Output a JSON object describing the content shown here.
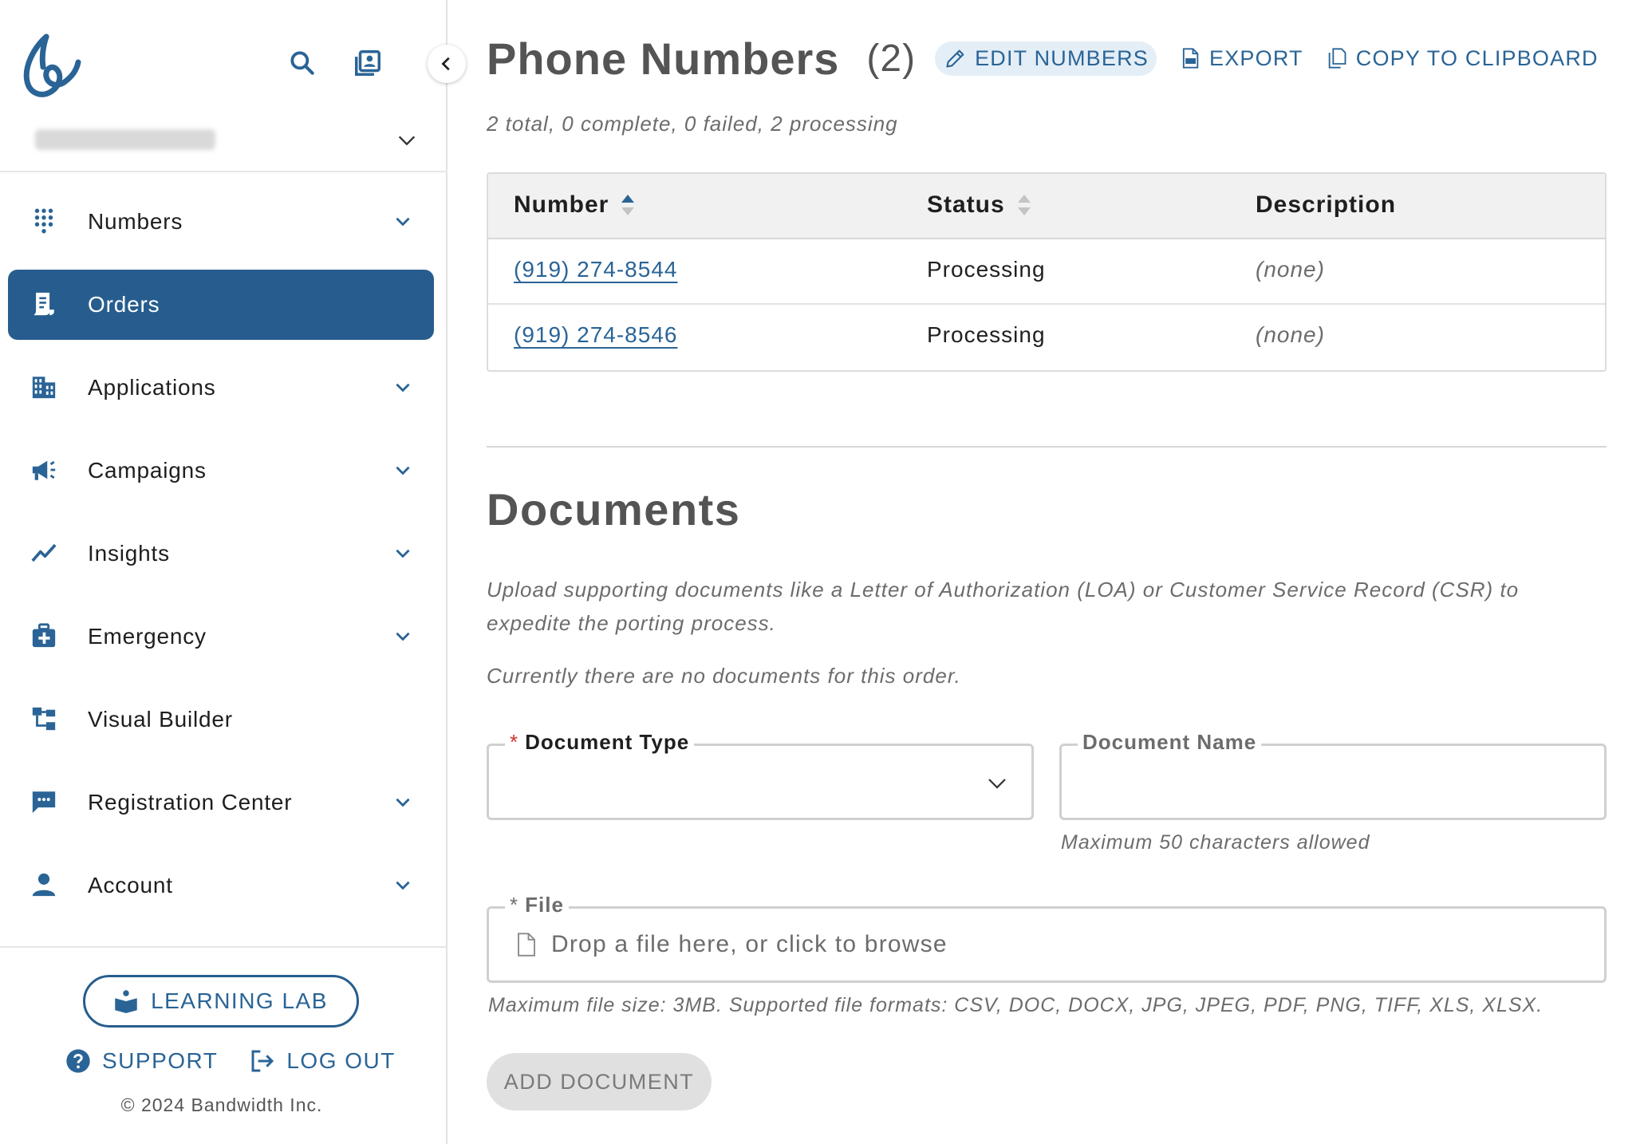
{
  "sidebar": {
    "account_chevron": "chevron-down-icon",
    "nav": [
      {
        "label": "Numbers",
        "icon": "dialpad-icon",
        "has_submenu": true,
        "active": false
      },
      {
        "label": "Orders",
        "icon": "receipt-icon",
        "has_submenu": false,
        "active": true
      },
      {
        "label": "Applications",
        "icon": "building-icon",
        "has_submenu": true,
        "active": false
      },
      {
        "label": "Campaigns",
        "icon": "megaphone-icon",
        "has_submenu": true,
        "active": false
      },
      {
        "label": "Insights",
        "icon": "trend-line-icon",
        "has_submenu": true,
        "active": false
      },
      {
        "label": "Emergency",
        "icon": "medical-kit-icon",
        "has_submenu": true,
        "active": false
      },
      {
        "label": "Visual Builder",
        "icon": "flow-builder-icon",
        "has_submenu": false,
        "active": false
      },
      {
        "label": "Registration Center",
        "icon": "chat-bubble-icon",
        "has_submenu": true,
        "active": false
      },
      {
        "label": "Account",
        "icon": "person-icon",
        "has_submenu": true,
        "active": false
      }
    ],
    "learning_lab": "LEARNING LAB",
    "support": "SUPPORT",
    "logout": "LOG OUT",
    "copyright": "© 2024 Bandwidth Inc."
  },
  "phone_numbers": {
    "title": "Phone Numbers",
    "count": "(2)",
    "actions": {
      "edit": "EDIT NUMBERS",
      "export": "EXPORT",
      "copy": "COPY TO CLIPBOARD"
    },
    "summary": "2 total, 0 complete, 0 failed, 2 processing",
    "columns": {
      "number": "Number",
      "status": "Status",
      "description": "Description"
    },
    "rows": [
      {
        "number": "(919) 274-8544",
        "status": "Processing",
        "description": "(none)"
      },
      {
        "number": "(919) 274-8546",
        "status": "Processing",
        "description": "(none)"
      }
    ]
  },
  "documents": {
    "title": "Documents",
    "description": "Upload supporting documents like a Letter of Authorization (LOA) or Customer Service Record (CSR) to expedite the porting process.",
    "empty": "Currently there are no documents for this order.",
    "document_type_label": "Document Type",
    "document_name_label": "Document Name",
    "document_name_helper": "Maximum 50 characters allowed",
    "file_label": "File",
    "file_placeholder": "Drop a file here, or click to browse",
    "file_helper": "Maximum file size: 3MB. Supported file formats: CSV, DOC, DOCX, JPG, JPEG, PDF, PNG, TIFF, XLS, XLSX.",
    "add_button": "ADD DOCUMENT"
  },
  "colors": {
    "brand": "#275d8e",
    "link": "#2a6496",
    "required": "#d0342c"
  }
}
